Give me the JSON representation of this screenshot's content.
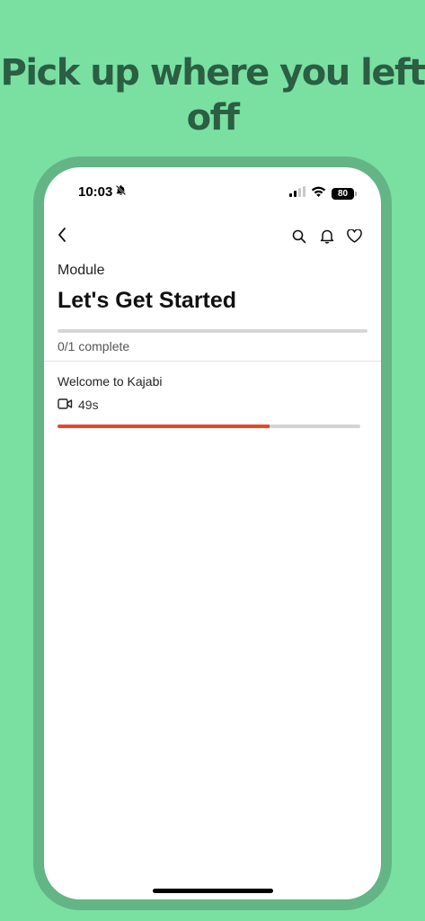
{
  "headline": "Pick up where you left off",
  "status_bar": {
    "time": "10:03",
    "battery": "80"
  },
  "module": {
    "label": "Module",
    "title": "Let's Get Started",
    "progress": 0,
    "complete_text": "0/1 complete"
  },
  "lessons": [
    {
      "title": "Welcome to Kajabi",
      "duration": "49s",
      "type_icon": "video-icon",
      "progress": 0.7
    }
  ],
  "icons": {
    "back": "chevron-left-icon",
    "search": "search-icon",
    "notifications": "bell-icon",
    "favorite": "heart-icon",
    "mute": "bell-slash-icon"
  },
  "colors": {
    "background": "#79e0a2",
    "phone_frame": "#63b585",
    "headline": "#2b5e42",
    "accent": "#e8472a"
  }
}
